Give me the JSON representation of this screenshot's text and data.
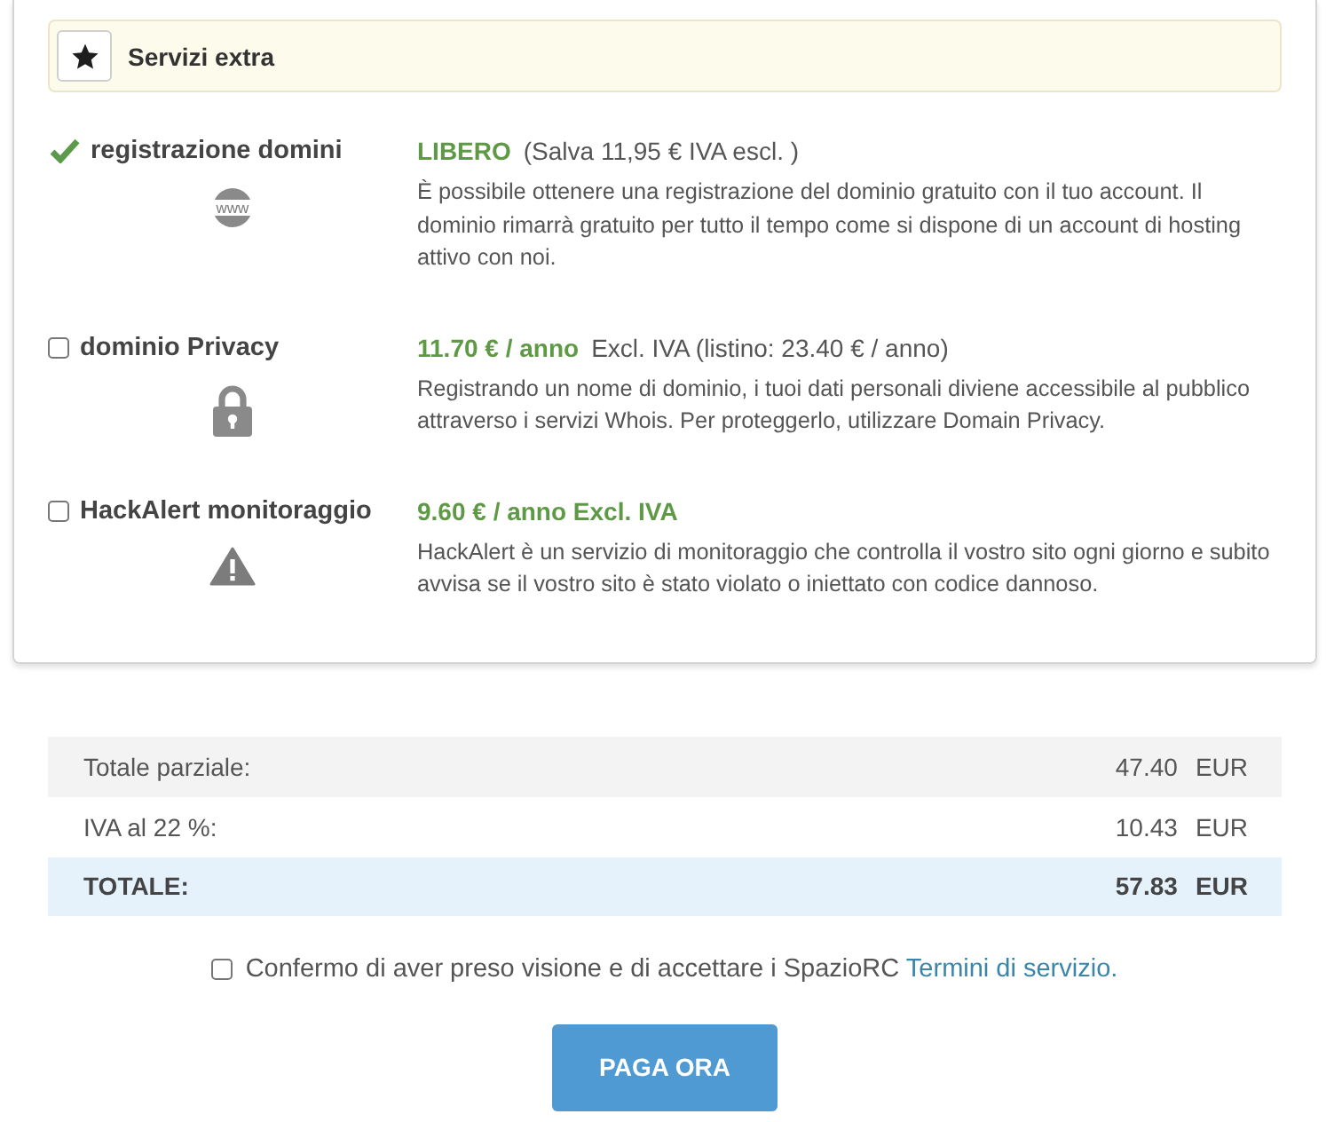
{
  "extras": {
    "title": "Servizi extra",
    "services": [
      {
        "kind": "included",
        "name": "registrazione domini",
        "badge": "www",
        "price": "LIBERO",
        "price_note": "(Salva 11,95 € IVA escl. )",
        "description": "È possibile ottenere una registrazione del dominio gratuito con il tuo account. Il dominio rimarrà gratuito per tutto il tempo come si dispone di un account di hosting attivo con noi."
      },
      {
        "kind": "checkbox",
        "checked": false,
        "name": "dominio Privacy",
        "price": "11.70 € / anno",
        "price_note": "Excl. IVA (listino: 23.40 € / anno)",
        "description": "Registrando un nome di dominio, i tuoi dati personali diviene accessibile al pubblico attraverso i servizi Whois. Per proteggerlo, utilizzare Domain Privacy."
      },
      {
        "kind": "checkbox",
        "checked": false,
        "name": "HackAlert monitoraggio",
        "price": "9.60 € / anno Excl. IVA",
        "description": "HackAlert è un servizio di monitoraggio che controlla il vostro sito ogni giorno e subito avvisa se il vostro sito è stato violato o iniettato con codice dannoso."
      }
    ]
  },
  "totals": [
    {
      "kind": "line",
      "label": "Totale parziale:",
      "amount": "47.40",
      "currency": "EUR"
    },
    {
      "kind": "line",
      "label": "IVA al 22 %:",
      "amount": "10.43",
      "currency": "EUR"
    },
    {
      "kind": "total",
      "label": "TOTALE:",
      "amount": "57.83",
      "currency": "EUR"
    }
  ],
  "terms": {
    "checked": false,
    "text": "Confermo di aver preso visione e di accettare i SpazioRC",
    "link": "Termini di servizio."
  },
  "pay_button": "PAGA ORA"
}
